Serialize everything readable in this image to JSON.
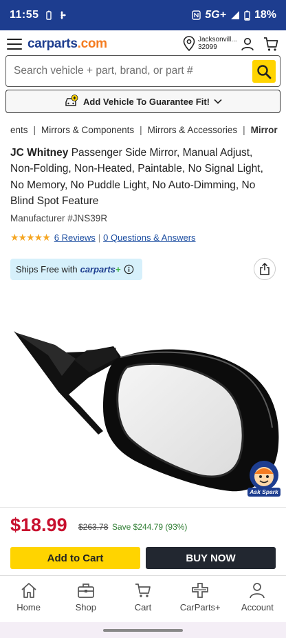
{
  "status_bar": {
    "time": "11:55",
    "network": "5G+",
    "battery": "18%"
  },
  "header": {
    "logo_main": "carparts",
    "logo_tld": ".com",
    "location_line1": "Jacksonvill...",
    "location_line2": "32099"
  },
  "search": {
    "placeholder": "Search vehicle + part, brand, or part #"
  },
  "vehicle_bar": {
    "label": "Add Vehicle To Guarantee Fit!"
  },
  "breadcrumb": {
    "items": [
      "ents",
      "Mirrors & Components",
      "Mirrors & Accessories"
    ],
    "current": "Mirror"
  },
  "product": {
    "brand": "JC Whitney",
    "title": "Passenger Side Mirror, Manual Adjust, Non-Folding, Non-Heated, Paintable, No Signal Light, No Memory, No Puddle Light, No Auto-Dimming, No Blind Spot Feature",
    "manufacturer": "Manufacturer #JNS39R",
    "rating_stars": 5,
    "reviews": "6 Reviews",
    "qa": "0 Questions & Answers",
    "ships_free_prefix": "Ships Free with",
    "ships_free_brand": "carparts",
    "ask_spark": "Ask Spark"
  },
  "pricing": {
    "price": "$18.99",
    "was": "$263.78",
    "save": "Save $244.79 (93%)"
  },
  "actions": {
    "add_to_cart": "Add to Cart",
    "buy_now": "BUY NOW"
  },
  "tabbar": {
    "items": [
      {
        "label": "Home",
        "icon": "home-icon"
      },
      {
        "label": "Shop",
        "icon": "toolbox-icon"
      },
      {
        "label": "Cart",
        "icon": "cart-icon"
      },
      {
        "label": "CarParts+",
        "icon": "carparts-plus-icon"
      },
      {
        "label": "Account",
        "icon": "account-icon"
      }
    ]
  },
  "colors": {
    "brand_blue": "#1d3d8f",
    "accent_yellow": "#ffd400",
    "price_red": "#c8102e",
    "save_green": "#2e7d32"
  }
}
